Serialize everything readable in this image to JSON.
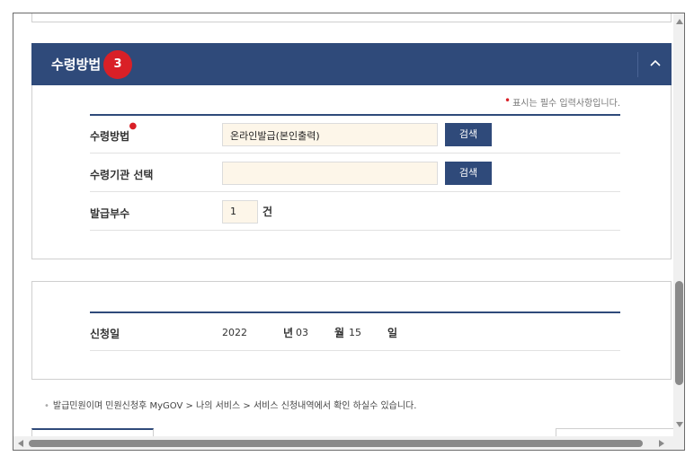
{
  "section": {
    "title": "수령방법",
    "step_number": "3"
  },
  "form": {
    "required_note": "표시는 필수 입력사항입니다.",
    "rows": [
      {
        "label": "수령방법",
        "value": "온라인발급(본인출력)",
        "button": "검색",
        "required": true
      },
      {
        "label": "수령기관 선택",
        "value": "",
        "button": "검색",
        "required": false
      },
      {
        "label": "발급부수",
        "value": "1",
        "unit": "건"
      }
    ]
  },
  "date": {
    "label": "신청일",
    "year": "2022",
    "year_unit": "년",
    "month": "03",
    "month_unit": "월",
    "day": "15",
    "day_unit": "일"
  },
  "notice": "발급민원이며 민원신청후 MyGOV > 나의 서비스 > 서비스 신청내역에서 확인 하실수 있습니다.",
  "colors": {
    "header_bg": "#2f4a7a",
    "badge_bg": "#d92027",
    "field_bg": "#fdf6e9"
  },
  "icons": {
    "collapse": "chevron-up-icon"
  }
}
